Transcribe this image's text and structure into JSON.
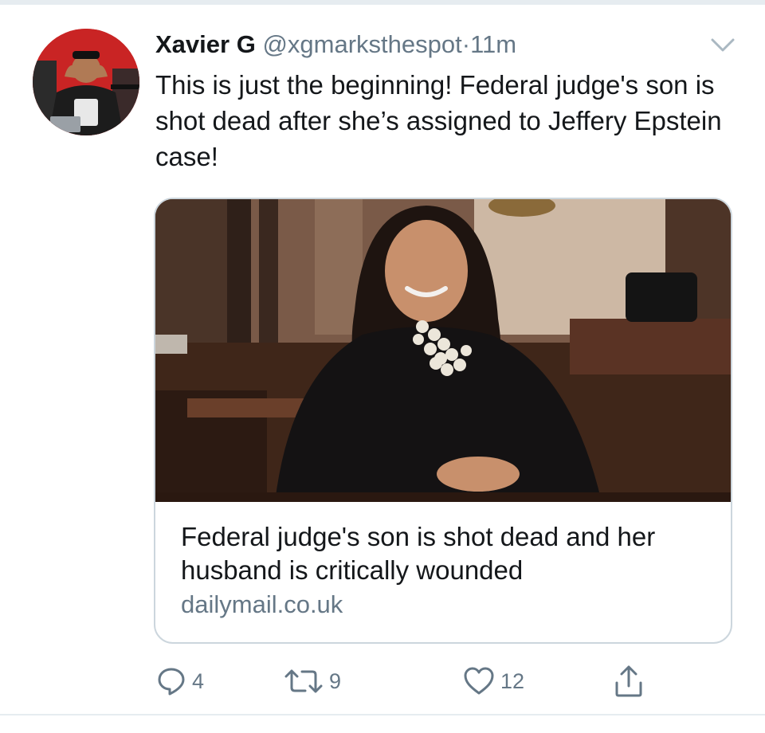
{
  "tweet": {
    "display_name": "Xavier G",
    "handle": "@xgmarksthespot",
    "separator": "·",
    "time": "11m",
    "text": "This is just the beginning! Federal judge's son is shot dead after she’s assigned to Jeffery Epstein case!"
  },
  "card": {
    "title": "Federal judge's son is shot dead and her husband is critically wounded",
    "domain": "dailymail.co.uk"
  },
  "actions": {
    "reply_count": "4",
    "retweet_count": "9",
    "like_count": "12"
  },
  "icons": {
    "menu": "chevron-down-icon",
    "reply": "reply-icon",
    "retweet": "retweet-icon",
    "like": "heart-icon",
    "share": "share-icon"
  },
  "colors": {
    "text_primary": "#14171a",
    "text_secondary": "#657786",
    "border": "#ccd6dd",
    "divider": "#e6ecf0"
  }
}
